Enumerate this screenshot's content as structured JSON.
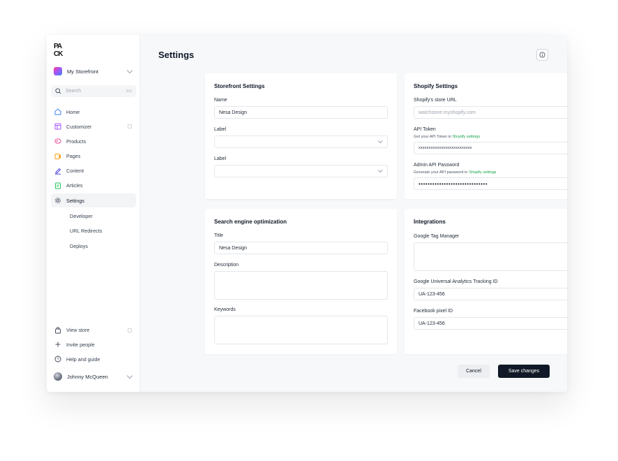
{
  "sidebar": {
    "logo_text": "PA CK",
    "store_name": "My Storefront",
    "search": {
      "placeholder": "Search",
      "shortcut": "⌘K"
    },
    "nav": [
      {
        "label": "Home",
        "icon": "home-icon"
      },
      {
        "label": "Customizer",
        "icon": "layout-icon"
      },
      {
        "label": "Products",
        "icon": "tag-icon"
      },
      {
        "label": "Pages",
        "icon": "pages-icon"
      },
      {
        "label": "Content",
        "icon": "pencil-icon"
      },
      {
        "label": "Articles",
        "icon": "article-icon"
      },
      {
        "label": "Settings",
        "icon": "gear-icon",
        "active": true
      }
    ],
    "sub_nav": [
      "Developer",
      "URL Redirects",
      "Deploys"
    ],
    "bottom_nav": [
      {
        "label": "View store",
        "icon": "bag-icon"
      },
      {
        "label": "Invite people",
        "icon": "plus-icon"
      },
      {
        "label": "Help and guide",
        "icon": "help-icon"
      }
    ],
    "user_name": "Johnny McQueen"
  },
  "header": {
    "title": "Settings"
  },
  "storefront_settings": {
    "title": "Storefront Settings",
    "name_label": "Name",
    "name_value": "Nesa Design",
    "label1": "Label",
    "label2": "Label"
  },
  "shopify_settings": {
    "title": "Shopify Settings",
    "store_url_label": "Shopify's store URL",
    "store_url_placeholder": "watchstore.myshopify.com",
    "api_token_label": "API Token",
    "api_token_hint": "Get your API Token in ",
    "api_token_link": "Shopify settings",
    "api_token_value": "xxxxxxxxxxxxxxxxxxxxxxxxxx",
    "admin_pw_label": "Admin API Password",
    "admin_pw_hint": "Generate your API password in ",
    "admin_pw_link": "Shopify settings",
    "admin_pw_value": "••••••••••••••••••••••••••••••"
  },
  "seo": {
    "title": "Search engine optimization",
    "title_label": "Title",
    "title_value": "Nesa Design",
    "description_label": "Description",
    "keywords_label": "Keywords"
  },
  "integrations": {
    "title": "Integrations",
    "gtm_label": "Google Tag Manager",
    "ga_label": "Google Universal Analytics Tracking ID",
    "ga_value": "UA-123-456",
    "fb_label": "Facebook pixel ID",
    "fb_value": "UA-123-456"
  },
  "actions": {
    "cancel": "Cancel",
    "save": "Save changes"
  },
  "colors": {
    "accent": "#111827",
    "link": "#16a34a",
    "products_icon": "#ec4899",
    "customizer_icon": "#a855f7",
    "pages_icon": "#f59e0b",
    "content_icon": "#4f46e5",
    "articles_icon": "#22c55e",
    "home_icon": "#3b82f6"
  }
}
